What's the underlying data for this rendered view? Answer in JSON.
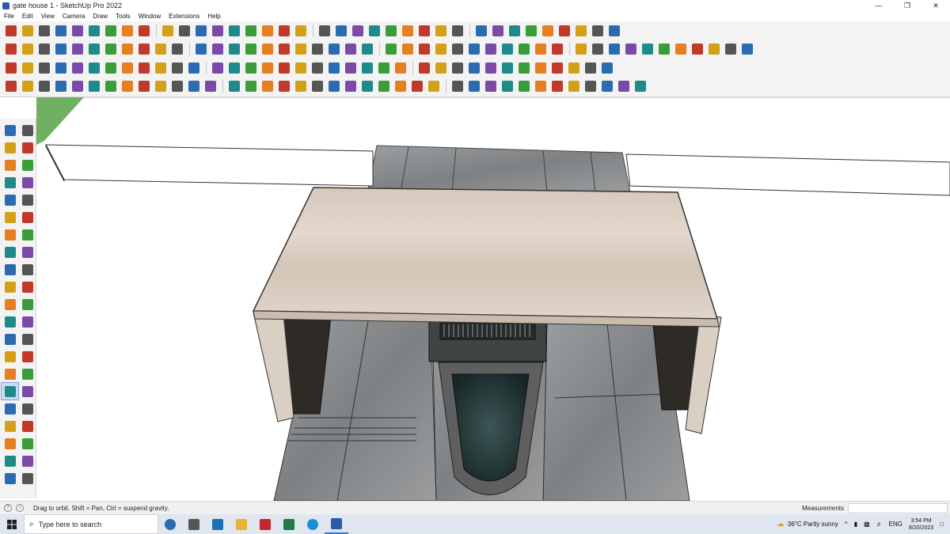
{
  "window": {
    "title": "gate house 1 - SketchUp Pro 2022",
    "minimize": "—",
    "restore": "❐",
    "close": "✕"
  },
  "menu": [
    "File",
    "Edit",
    "View",
    "Camera",
    "Draw",
    "Tools",
    "Window",
    "Extensions",
    "Help"
  ],
  "toolbar_palette": [
    "#c0392b",
    "#2b6cb0",
    "#3a9d3a",
    "#d4a017",
    "#7b4aa8",
    "#e67e22",
    "#555555",
    "#1f8a8a"
  ],
  "status": {
    "message": "Drag to orbit. Shift = Pan, Ctrl = suspend gravity.",
    "measurements_label": "Measurements",
    "measurements_value": ""
  },
  "taskbar": {
    "search_placeholder": "Type here to search",
    "weather": "36°C  Partly sunny",
    "language": "ENG",
    "time": "3:54 PM",
    "date": "8/20/2023"
  },
  "viewport": {
    "sky_color": "#ffffff",
    "ground_color": "#6fb063",
    "wall_color": "#ffffff",
    "roof_color": "#d8ccbf",
    "floor_color": "#8a8d8f",
    "water_color": "#2a3c3c"
  }
}
